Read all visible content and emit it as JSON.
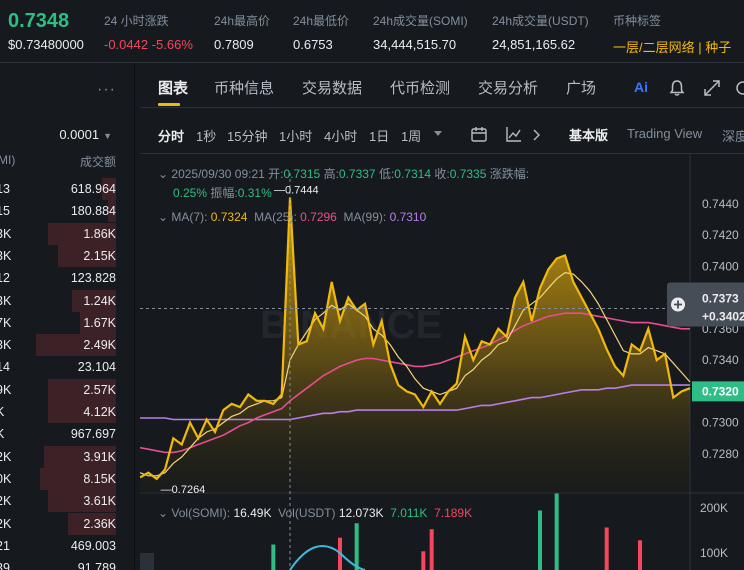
{
  "ticker": {
    "price": "0.7348",
    "price_sub": "$0.73480000",
    "stats": [
      {
        "label": "24 小时涨跌",
        "value": "-0.0442 -5.66%",
        "tone": "red"
      },
      {
        "label": "24h最高价",
        "value": "0.7809",
        "tone": ""
      },
      {
        "label": "24h最低价",
        "value": "0.6753",
        "tone": ""
      },
      {
        "label": "24h成交量(SOMI)",
        "value": "34,444,515.70",
        "tone": ""
      },
      {
        "label": "24h成交量(USDT)",
        "value": "24,851,165.62",
        "tone": ""
      },
      {
        "label": "币种标签",
        "value": "一层/二层网络 | 种子",
        "tone": "gold"
      }
    ]
  },
  "order_book": {
    "step": "0.0001",
    "header_left": "MI)",
    "header_right": "成交额",
    "rows": [
      {
        "p": "13",
        "v": "618.964",
        "bar": 0.18
      },
      {
        "p": "15",
        "v": "180.884",
        "bar": 0.1
      },
      {
        "p": "3K",
        "v": "1.86K",
        "bar": 0.85
      },
      {
        "p": "3K",
        "v": "2.15K",
        "bar": 0.72
      },
      {
        "p": "12",
        "v": "123.828",
        "bar": 0.0
      },
      {
        "p": "3K",
        "v": "1.24K",
        "bar": 0.55
      },
      {
        "p": "7K",
        "v": "1.67K",
        "bar": 0.45
      },
      {
        "p": "3K",
        "v": "2.49K",
        "bar": 1.0
      },
      {
        "p": "14",
        "v": "23.104",
        "bar": 0.0
      },
      {
        "p": "9K",
        "v": "2.57K",
        "bar": 0.85
      },
      {
        "p": "K",
        "v": "4.12K",
        "bar": 0.85
      },
      {
        "p": "K",
        "v": "967.697",
        "bar": 0.0
      },
      {
        "p": "2K",
        "v": "3.91K",
        "bar": 0.9
      },
      {
        "p": "0K",
        "v": "8.15K",
        "bar": 0.95
      },
      {
        "p": "2K",
        "v": "3.61K",
        "bar": 0.85
      },
      {
        "p": "2K",
        "v": "2.36K",
        "bar": 0.6
      },
      {
        "p": "21",
        "v": "469.003",
        "bar": 0.0
      },
      {
        "p": "39",
        "v": "91.789",
        "bar": 0.0
      }
    ]
  },
  "tabs": [
    "图表",
    "币种信息",
    "交易数据",
    "代币检测",
    "交易分析",
    "广场"
  ],
  "ai_label": "Ai",
  "timeframes": [
    "分时",
    "1秒",
    "15分钟",
    "1小时",
    "4小时",
    "1日",
    "1周"
  ],
  "view_modes": {
    "basic": "基本版",
    "tradingview": "Trading View",
    "depth": "深度"
  },
  "ohlc": {
    "date": "2025/09/30 09:21",
    "open_label": "开:",
    "open": "0.7315",
    "high_label": "高:",
    "high": "0.7337",
    "low_label": "低:",
    "low": "0.7314",
    "close_label": "收:",
    "close": "0.7335",
    "change_label": "涨跌幅:",
    "change": "0.25%",
    "amp_label": "振幅:",
    "amp": "0.31%"
  },
  "ma": {
    "ma7_label": "MA(7):",
    "ma7": "0.7324",
    "ma25_label": "MA(25):",
    "ma25": "0.7296",
    "ma99_label": "MA(99):",
    "ma99": "0.7310"
  },
  "volume": {
    "label_somi": "Vol(SOMI):",
    "somi": "16.49K",
    "label_usdt": "Vol(USDT)",
    "usdt": "12.073K",
    "v2": "7.011K",
    "v3": "7.189K"
  },
  "colors": {
    "up": "#2ebd85",
    "down": "#f6465d",
    "accent": "#f0b90b",
    "ma25": "#e84d91",
    "ma99": "#b87fe8",
    "cyan": "#3fb9d8"
  },
  "chart_data": {
    "type": "area",
    "ylim": [
      0.7255,
      0.7452
    ],
    "y_ticks": [
      "0.7440",
      "0.7420",
      "0.7400",
      "0.7380",
      "0.7360",
      "0.7340",
      "0.7320",
      "0.7300",
      "0.7280"
    ],
    "price_series": [
      0.7265,
      0.7268,
      0.7264,
      0.727,
      0.729,
      0.7286,
      0.73,
      0.729,
      0.7302,
      0.7294,
      0.7308,
      0.7312,
      0.731,
      0.7318,
      0.7314,
      0.7314,
      0.7312,
      0.7318,
      0.7444,
      0.735,
      0.7352,
      0.737,
      0.736,
      0.739,
      0.7365,
      0.738,
      0.7372,
      0.7376,
      0.735,
      0.7365,
      0.7338,
      0.7324,
      0.732,
      0.7318,
      0.731,
      0.732,
      0.7312,
      0.732,
      0.7325,
      0.7355,
      0.734,
      0.7352,
      0.735,
      0.736,
      0.7355,
      0.738,
      0.739,
      0.7365,
      0.7386,
      0.7398,
      0.7405,
      0.7407,
      0.739,
      0.738,
      0.737,
      0.736,
      0.7347,
      0.7336,
      0.733,
      0.735,
      0.7346,
      0.736,
      0.734,
      0.7344,
      0.7316,
      0.732,
      0.7322
    ],
    "ma7_series": [
      0.7268,
      0.7266,
      0.7266,
      0.7268,
      0.7274,
      0.7278,
      0.7284,
      0.729,
      0.7294,
      0.7296,
      0.73,
      0.7304,
      0.7306,
      0.731,
      0.7312,
      0.7314,
      0.7314,
      0.7316,
      0.734,
      0.735,
      0.7358,
      0.7366,
      0.737,
      0.7375,
      0.7372,
      0.7376,
      0.7372,
      0.7368,
      0.736,
      0.7356,
      0.735,
      0.7342,
      0.7336,
      0.7328,
      0.7322,
      0.732,
      0.7318,
      0.732,
      0.7322,
      0.733,
      0.7334,
      0.734,
      0.7344,
      0.735,
      0.7352,
      0.7362,
      0.7372,
      0.7376,
      0.738,
      0.7386,
      0.7392,
      0.7396,
      0.7395,
      0.739,
      0.7384,
      0.7376,
      0.7366,
      0.7356,
      0.7346,
      0.7344,
      0.7344,
      0.7348,
      0.7346,
      0.7344,
      0.7338,
      0.7332,
      0.7326
    ],
    "ma25_series": [
      0.7284,
      0.7283,
      0.7282,
      0.7281,
      0.7281,
      0.7282,
      0.7284,
      0.7286,
      0.7288,
      0.729,
      0.7292,
      0.7295,
      0.7298,
      0.73,
      0.7303,
      0.7305,
      0.7307,
      0.7309,
      0.7314,
      0.7318,
      0.7322,
      0.7326,
      0.733,
      0.7333,
      0.7336,
      0.7338,
      0.734,
      0.7341,
      0.7341,
      0.734,
      0.7339,
      0.7338,
      0.7337,
      0.7336,
      0.7336,
      0.7337,
      0.7338,
      0.734,
      0.7342,
      0.7344,
      0.7346,
      0.7348,
      0.735,
      0.7353,
      0.7356,
      0.7359,
      0.7362,
      0.7364,
      0.7366,
      0.7368,
      0.7369,
      0.737,
      0.737,
      0.737,
      0.7369,
      0.7368,
      0.7367,
      0.7366,
      0.7365,
      0.7364,
      0.7364,
      0.7364,
      0.7363,
      0.7362,
      0.7361,
      0.736,
      0.736
    ],
    "ma99_series": [
      0.7303,
      0.7303,
      0.7303,
      0.7303,
      0.7302,
      0.7302,
      0.7302,
      0.7302,
      0.7302,
      0.7302,
      0.7302,
      0.7302,
      0.7302,
      0.7302,
      0.7302,
      0.7302,
      0.7302,
      0.7302,
      0.7302,
      0.7303,
      0.7304,
      0.7305,
      0.7306,
      0.7306,
      0.7307,
      0.7307,
      0.7308,
      0.7308,
      0.7308,
      0.7308,
      0.7308,
      0.7308,
      0.7308,
      0.7308,
      0.7308,
      0.7308,
      0.7308,
      0.7308,
      0.7308,
      0.7309,
      0.731,
      0.7311,
      0.7311,
      0.7312,
      0.7313,
      0.7314,
      0.7315,
      0.7316,
      0.7316,
      0.7317,
      0.7318,
      0.7319,
      0.732,
      0.7321,
      0.7321,
      0.7321,
      0.7322,
      0.7322,
      0.7323,
      0.7324,
      0.7324,
      0.7324,
      0.7324,
      0.7324,
      0.7324,
      0.7324,
      0.7324
    ],
    "high_label": "0.7444",
    "low_label": "0.7264",
    "crosshair_price": "0.7373",
    "crosshair_change": "+0.3402",
    "last_price": "0.7320",
    "volume_ticks": [
      "200K",
      "100K"
    ],
    "volume_bars": [
      {
        "i": 16,
        "value": 30,
        "dir": "up"
      },
      {
        "i": 24,
        "value": 38,
        "dir": "down"
      },
      {
        "i": 26,
        "value": 55,
        "dir": "up"
      },
      {
        "i": 34,
        "value": 22,
        "dir": "down"
      },
      {
        "i": 35,
        "value": 48,
        "dir": "down"
      },
      {
        "i": 48,
        "value": 70,
        "dir": "up"
      },
      {
        "i": 50,
        "value": 90,
        "dir": "up"
      },
      {
        "i": 56,
        "value": 50,
        "dir": "down"
      },
      {
        "i": 60,
        "value": 35,
        "dir": "down"
      }
    ]
  }
}
